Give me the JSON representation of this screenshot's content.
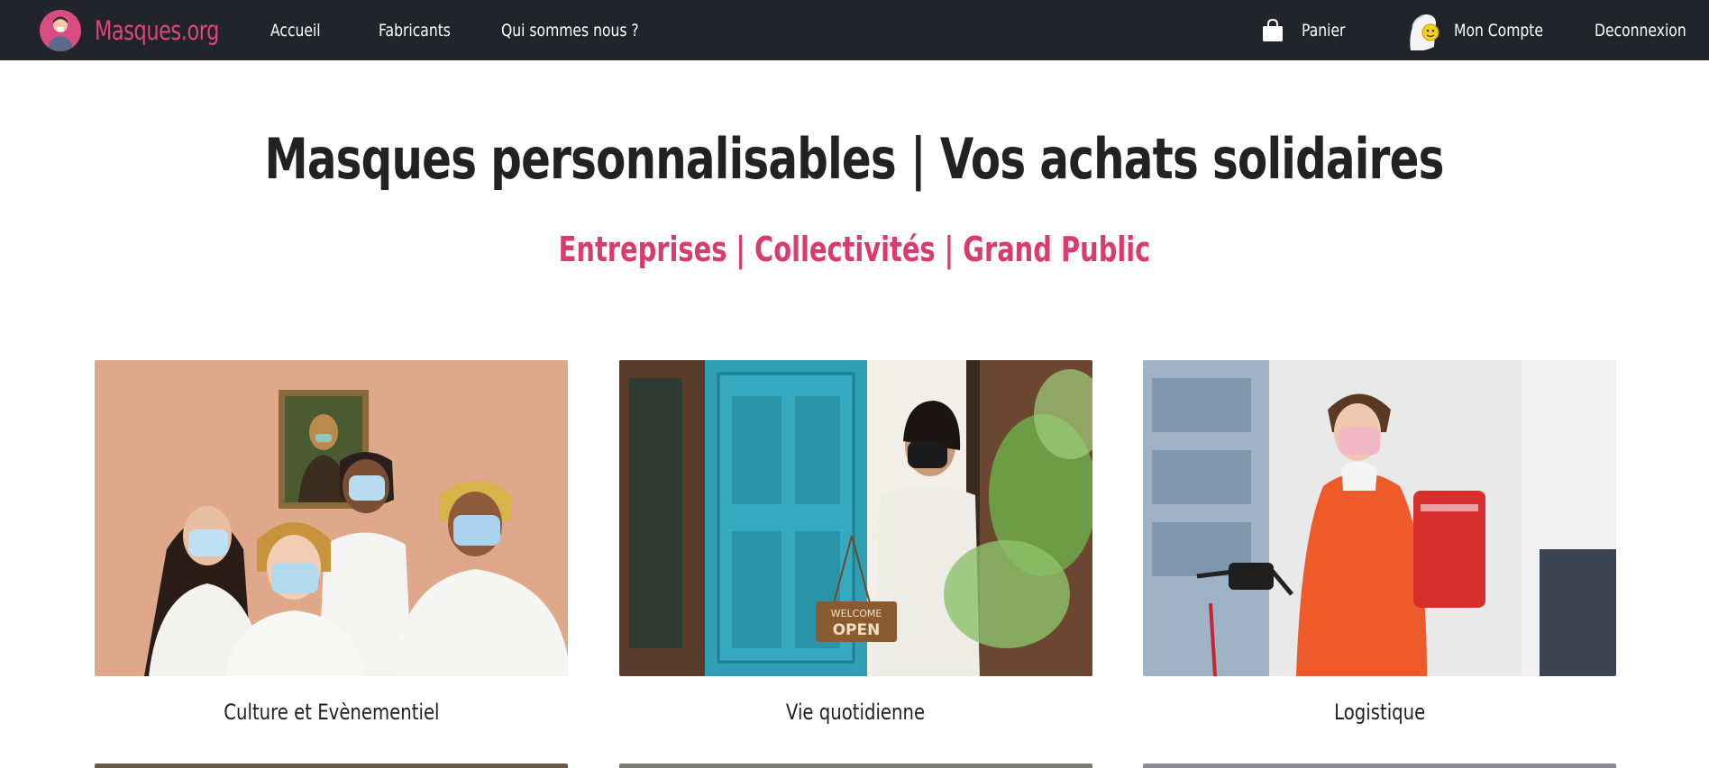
{
  "nav": {
    "brand": "Masques.org",
    "links": [
      "Accueil",
      "Fabricants",
      "Qui sommes nous ?"
    ],
    "cart_label": "Panier",
    "account_label": "Mon Compte",
    "logout_label": "Deconnexion"
  },
  "hero": {
    "title": "Masques personnalisables | Vos achats solidaires",
    "subtitle": "Entreprises | Collectivités | Grand Public"
  },
  "cards": [
    {
      "label": "Culture et Evènementiel",
      "image": "group-wearing-masks-photo"
    },
    {
      "label": "Vie quotidienne",
      "image": "shop-open-sign-photo"
    },
    {
      "label": "Logistique",
      "image": "delivery-cyclist-photo"
    }
  ],
  "colors": {
    "navbar": "#212529",
    "brand": "#e0457b",
    "accent": "#d93b6f",
    "title": "#222222"
  }
}
